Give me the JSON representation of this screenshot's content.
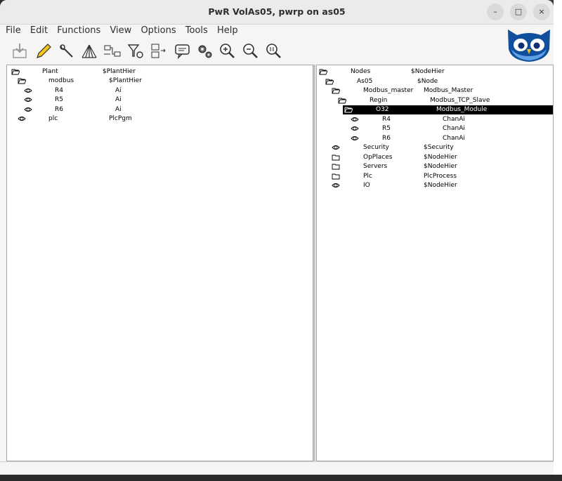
{
  "window": {
    "title": "PwR VolAs05,  pwrp on as05",
    "controls": {
      "minimize": "–",
      "maximize": "□",
      "close": "×"
    }
  },
  "menu": [
    "File",
    "Edit",
    "Functions",
    "View",
    "Options",
    "Tools",
    "Help"
  ],
  "toolbar": [
    {
      "icon": "import-icon"
    },
    {
      "icon": "edit-pencil-icon"
    },
    {
      "icon": "wrench-icon"
    },
    {
      "icon": "hierarchy-tree-icon"
    },
    {
      "icon": "connection-icon"
    },
    {
      "icon": "filter-icon"
    },
    {
      "icon": "move-object-icon"
    },
    {
      "icon": "comment-icon"
    },
    {
      "icon": "gears-icon"
    },
    {
      "icon": "zoom-in-icon"
    },
    {
      "icon": "zoom-out-icon"
    },
    {
      "icon": "zoom-reset-icon"
    }
  ],
  "left_tree": [
    {
      "name": "Plant",
      "class": "$PlantHier",
      "icon": "folder-open",
      "level": 0
    },
    {
      "name": "modbus",
      "class": "$PlantHier",
      "icon": "folder-open",
      "level": 1
    },
    {
      "name": "R4",
      "class": "Ai",
      "icon": "leaf",
      "level": 2
    },
    {
      "name": "R5",
      "class": "Ai",
      "icon": "leaf",
      "level": 2
    },
    {
      "name": "R6",
      "class": "Ai",
      "icon": "leaf",
      "level": 2
    },
    {
      "name": "plc",
      "class": "PlcPgm",
      "icon": "leaf",
      "level": 1
    }
  ],
  "right_tree": [
    {
      "name": "Nodes",
      "class": "$NodeHier",
      "icon": "folder-open",
      "level": 0
    },
    {
      "name": "As05",
      "class": "$Node",
      "icon": "folder-open",
      "level": 1
    },
    {
      "name": "Modbus_master",
      "class": "Modbus_Master",
      "icon": "folder-open",
      "level": 2
    },
    {
      "name": "Regin",
      "class": "Modbus_TCP_Slave",
      "icon": "folder-open",
      "level": 3
    },
    {
      "name": "O32",
      "class": "Modbus_Module",
      "icon": "folder-open",
      "level": 4,
      "selected": true
    },
    {
      "name": "R4",
      "class": "ChanAi",
      "icon": "leaf",
      "level": 5
    },
    {
      "name": "R5",
      "class": "ChanAi",
      "icon": "leaf",
      "level": 5
    },
    {
      "name": "R6",
      "class": "ChanAi",
      "icon": "leaf",
      "level": 5
    },
    {
      "name": "Security",
      "class": "$Security",
      "icon": "leaf",
      "level": 2
    },
    {
      "name": "OpPlaces",
      "class": "$NodeHier",
      "icon": "folder-closed",
      "level": 2
    },
    {
      "name": "Servers",
      "class": "$NodeHier",
      "icon": "folder-closed",
      "level": 2
    },
    {
      "name": "Plc",
      "class": "PlcProcess",
      "icon": "folder-closed",
      "level": 2
    },
    {
      "name": "IO",
      "class": "$NodeHier",
      "icon": "leaf",
      "level": 2
    }
  ]
}
